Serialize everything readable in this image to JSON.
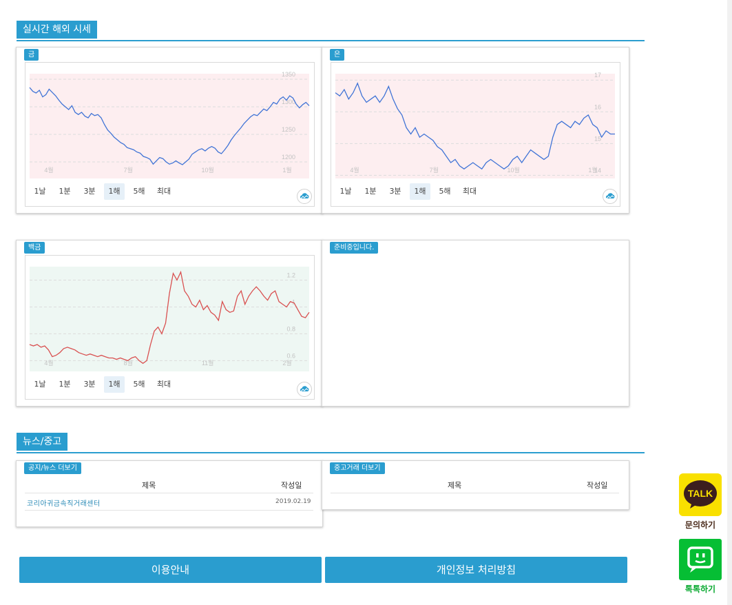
{
  "sections": {
    "market": "실시간 해외 시세",
    "news": "뉴스/중고"
  },
  "periods": [
    "1날",
    "1분",
    "3분",
    "1해",
    "5해",
    "최대"
  ],
  "active_period": "1해",
  "charts": {
    "gold": {
      "badge": "금",
      "y_ticks": [
        "1350",
        "1300",
        "1250",
        "1200"
      ],
      "x_ticks": [
        "4월",
        "7월",
        "10월",
        "1월"
      ],
      "line_color": "#3f73d6",
      "fill_color": "#fdeef0"
    },
    "silver": {
      "badge": "은",
      "y_ticks": [
        "17",
        "16",
        "15",
        "14"
      ],
      "x_ticks": [
        "4월",
        "7월",
        "10월",
        "1월"
      ],
      "line_color": "#3f73d6",
      "fill_color": "#fdeef0"
    },
    "platinum": {
      "badge": "백금",
      "y_ticks": [
        "1.2",
        "1",
        "0.8",
        "0.6"
      ],
      "x_ticks": [
        "4월",
        "8월",
        "11월",
        "2월"
      ],
      "line_color": "#d95050",
      "fill_color": "#eef7f3"
    },
    "pending": {
      "badge": "준비중입니다."
    }
  },
  "chart_data": [
    {
      "type": "line",
      "title": "금",
      "ylim": [
        1170,
        1360
      ],
      "x_ticks": [
        "4월",
        "7월",
        "10월",
        "1월"
      ],
      "values": [
        1335,
        1328,
        1325,
        1330,
        1318,
        1322,
        1332,
        1326,
        1320,
        1312,
        1305,
        1300,
        1295,
        1302,
        1290,
        1286,
        1290,
        1283,
        1280,
        1288,
        1284,
        1286,
        1280,
        1268,
        1258,
        1252,
        1245,
        1240,
        1235,
        1232,
        1226,
        1224,
        1222,
        1218,
        1216,
        1210,
        1208,
        1205,
        1196,
        1202,
        1208,
        1206,
        1200,
        1196,
        1198,
        1202,
        1198,
        1195,
        1200,
        1205,
        1214,
        1218,
        1222,
        1224,
        1220,
        1225,
        1228,
        1225,
        1218,
        1215,
        1222,
        1230,
        1240,
        1248,
        1255,
        1262,
        1270,
        1276,
        1282,
        1286,
        1284,
        1290,
        1296,
        1293,
        1300,
        1308,
        1305,
        1314,
        1318,
        1312,
        1320,
        1316,
        1305,
        1298,
        1304,
        1308,
        1302
      ],
      "y_ticks": [
        "1350",
        "1300",
        "1250",
        "1200"
      ]
    },
    {
      "type": "line",
      "title": "은",
      "ylim": [
        13.9,
        17.2
      ],
      "x_ticks": [
        "4월",
        "7월",
        "10월",
        "1월"
      ],
      "values": [
        16.6,
        16.5,
        16.7,
        16.4,
        16.6,
        16.9,
        16.5,
        16.3,
        16.4,
        16.5,
        16.3,
        16.5,
        16.8,
        16.4,
        16.1,
        15.9,
        15.5,
        15.3,
        15.5,
        15.2,
        15.3,
        15.2,
        15.1,
        14.9,
        14.8,
        14.6,
        14.4,
        14.5,
        14.3,
        14.2,
        14.3,
        14.4,
        14.3,
        14.2,
        14.4,
        14.5,
        14.4,
        14.3,
        14.2,
        14.3,
        14.5,
        14.6,
        14.4,
        14.6,
        14.8,
        14.7,
        14.6,
        14.5,
        14.6,
        15.2,
        15.6,
        15.7,
        15.6,
        15.5,
        15.7,
        15.6,
        15.8,
        15.9,
        15.6,
        15.5,
        15.2,
        15.4,
        15.3,
        15.3
      ],
      "y_ticks": [
        "17",
        "16",
        "15",
        "14"
      ]
    },
    {
      "type": "line",
      "title": "백금",
      "ylim": [
        0.52,
        1.3
      ],
      "x_ticks": [
        "4월",
        "8월",
        "11월",
        "2월"
      ],
      "values": [
        0.72,
        0.71,
        0.72,
        0.7,
        0.71,
        0.68,
        0.63,
        0.64,
        0.66,
        0.69,
        0.7,
        0.69,
        0.68,
        0.66,
        0.65,
        0.64,
        0.65,
        0.64,
        0.63,
        0.64,
        0.63,
        0.62,
        0.62,
        0.61,
        0.62,
        0.61,
        0.6,
        0.62,
        0.63,
        0.6,
        0.58,
        0.6,
        0.72,
        0.82,
        0.85,
        0.8,
        0.88,
        1.1,
        1.25,
        1.2,
        1.26,
        1.12,
        1.08,
        1.02,
        1.0,
        1.05,
        0.98,
        1.01,
        0.96,
        0.94,
        0.9,
        1.04,
        0.98,
        0.96,
        0.97,
        1.08,
        1.12,
        1.02,
        1.08,
        1.12,
        1.15,
        1.12,
        1.08,
        1.05,
        1.1,
        1.12,
        1.04,
        1.02,
        1.0,
        1.04,
        1.03,
        0.98,
        0.93,
        0.92,
        0.96
      ],
      "y_ticks": [
        "1.2",
        "1",
        "0.8",
        "0.6"
      ]
    }
  ],
  "news_card": {
    "badge": "공지/뉴스 더보기",
    "col_title": "제목",
    "col_date": "작성일",
    "rows": [
      {
        "title": "코리아귀금속직거래센터",
        "date": "2019.02.19"
      }
    ]
  },
  "used_card": {
    "badge": "중고거래 더보기",
    "col_title": "제목",
    "col_date": "작성일"
  },
  "footer": {
    "guide": "이용안내",
    "privacy": "개인정보 처리방침"
  },
  "floating": {
    "talk_logo": "TALK",
    "talk_label": "문의하기",
    "talk_color": "#f9e000",
    "talktalk_label": "톡톡하기",
    "talktalk_color": "#06be34"
  }
}
